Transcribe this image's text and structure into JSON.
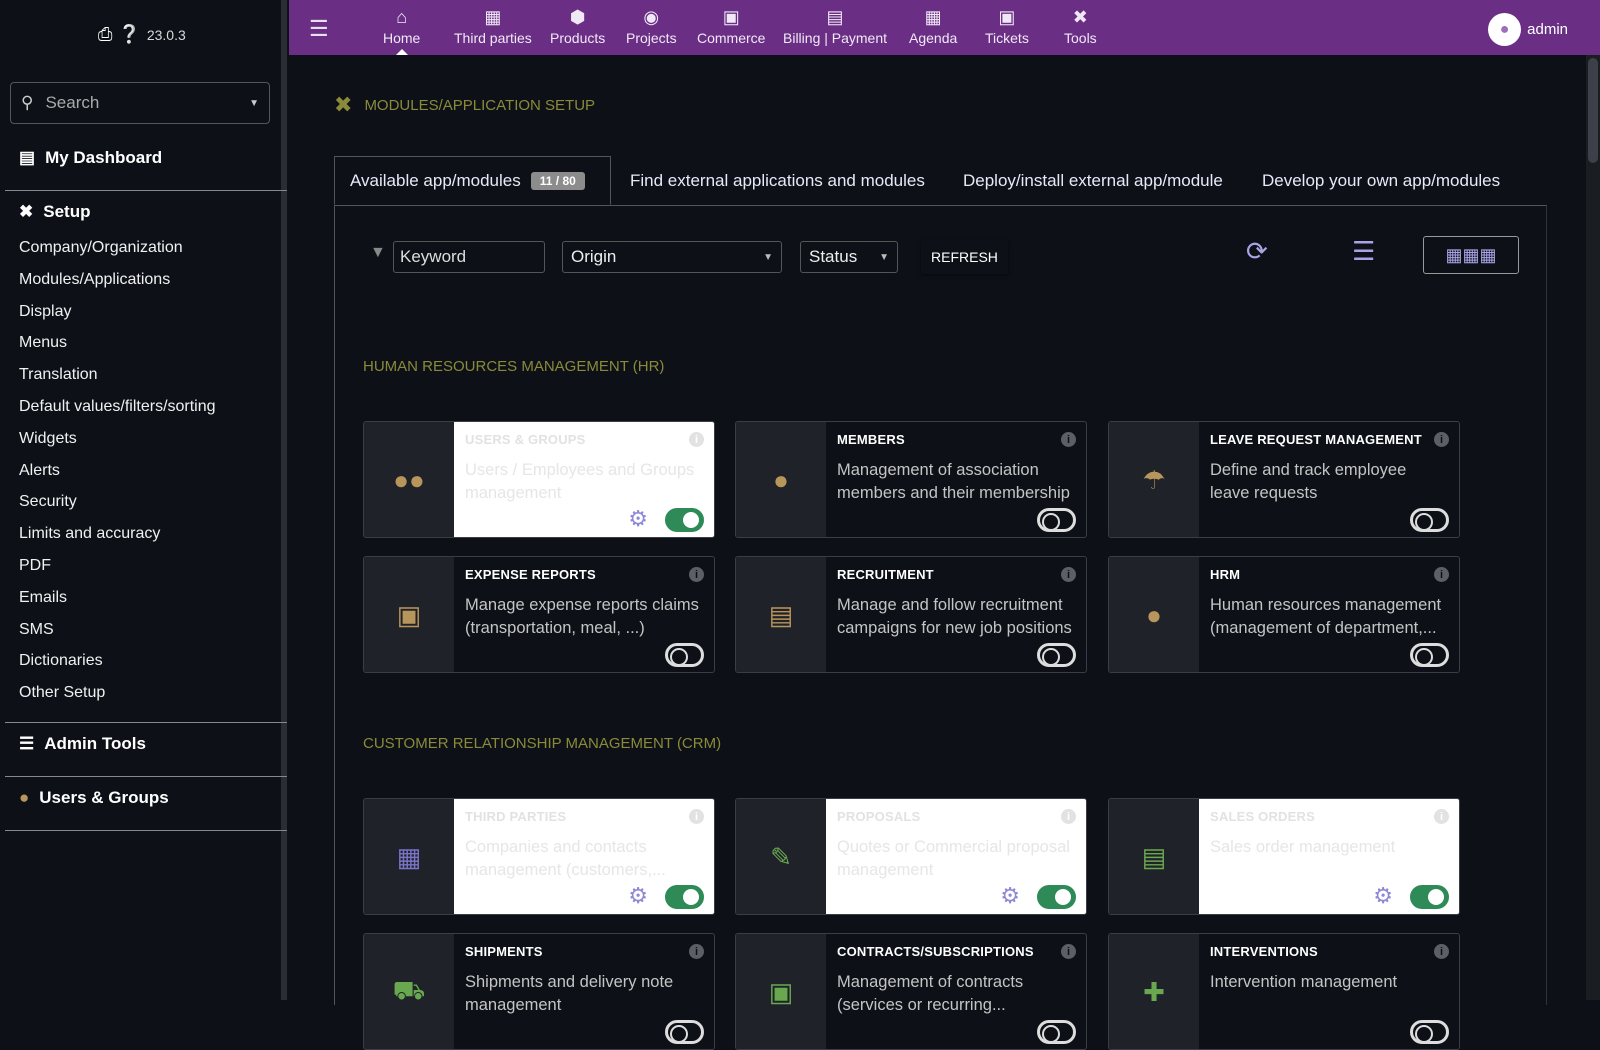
{
  "sidebar": {
    "version": "23.0.3",
    "search_placeholder": "Search",
    "dashboard": "My Dashboard",
    "setup": "Setup",
    "setup_items": [
      "Company/Organization",
      "Modules/Applications",
      "Display",
      "Menus",
      "Translation",
      "Default values/filters/sorting",
      "Widgets",
      "Alerts",
      "Security",
      "Limits and accuracy",
      "PDF",
      "Emails",
      "SMS",
      "Dictionaries",
      "Other Setup"
    ],
    "admin_tools": "Admin Tools",
    "users_groups": "Users & Groups"
  },
  "topnav": {
    "items": [
      "Home",
      "Third parties",
      "Products",
      "Projects",
      "Commerce",
      "Billing | Payment",
      "Agenda",
      "Tickets",
      "Tools"
    ],
    "user": "admin"
  },
  "page": {
    "title": "MODULES/APPLICATION SETUP",
    "tabs": [
      "Available app/modules",
      "Find external applications and modules",
      "Deploy/install external app/module",
      "Develop your own app/modules"
    ],
    "badge": "11 / 80",
    "keyword_placeholder": "Keyword",
    "origin": "Origin",
    "status": "Status",
    "refresh": "REFRESH"
  },
  "groups": {
    "hr": "HUMAN RESOURCES MANAGEMENT (HR)",
    "crm": "CUSTOMER RELATIONSHIP MANAGEMENT (CRM)"
  },
  "modules": [
    {
      "title": "USERS & GROUPS",
      "desc": "Users / Employees and Groups management",
      "enabled": true,
      "icon_color": "#b8955a"
    },
    {
      "title": "MEMBERS",
      "desc": "Management of association members and their membership",
      "enabled": false,
      "icon_color": "#b8955a"
    },
    {
      "title": "LEAVE REQUEST MANAGEMENT",
      "desc": "Define and track employee leave requests",
      "enabled": false,
      "icon_color": "#b8955a"
    },
    {
      "title": "EXPENSE REPORTS",
      "desc": "Manage expense reports claims (transportation, meal, ...)",
      "enabled": false,
      "icon_color": "#b8955a"
    },
    {
      "title": "RECRUITMENT",
      "desc": "Manage and follow recruitment campaigns for new job positions",
      "enabled": false,
      "icon_color": "#b8955a"
    },
    {
      "title": "HRM",
      "desc": "Human resources management (management of department,...",
      "enabled": false,
      "icon_color": "#b8955a"
    },
    {
      "title": "THIRD PARTIES",
      "desc": "Companies and contacts management (customers,...",
      "enabled": true,
      "icon_color": "#7a75c9"
    },
    {
      "title": "PROPOSALS",
      "desc": "Quotes or Commercial proposal management",
      "enabled": true,
      "icon_color": "#6aa84f"
    },
    {
      "title": "SALES ORDERS",
      "desc": "Sales order management",
      "enabled": true,
      "icon_color": "#6aa84f"
    },
    {
      "title": "SHIPMENTS",
      "desc": "Shipments and delivery note management",
      "enabled": false,
      "icon_color": "#6aa84f"
    },
    {
      "title": "CONTRACTS/SUBSCRIPTIONS",
      "desc": "Management of contracts (services or recurring...",
      "enabled": false,
      "icon_color": "#6aa84f"
    },
    {
      "title": "INTERVENTIONS",
      "desc": "Intervention management",
      "enabled": false,
      "icon_color": "#6aa84f"
    }
  ],
  "icons": {
    "accent": "#6a2f85",
    "group_title_color": "#8a8a3a"
  }
}
